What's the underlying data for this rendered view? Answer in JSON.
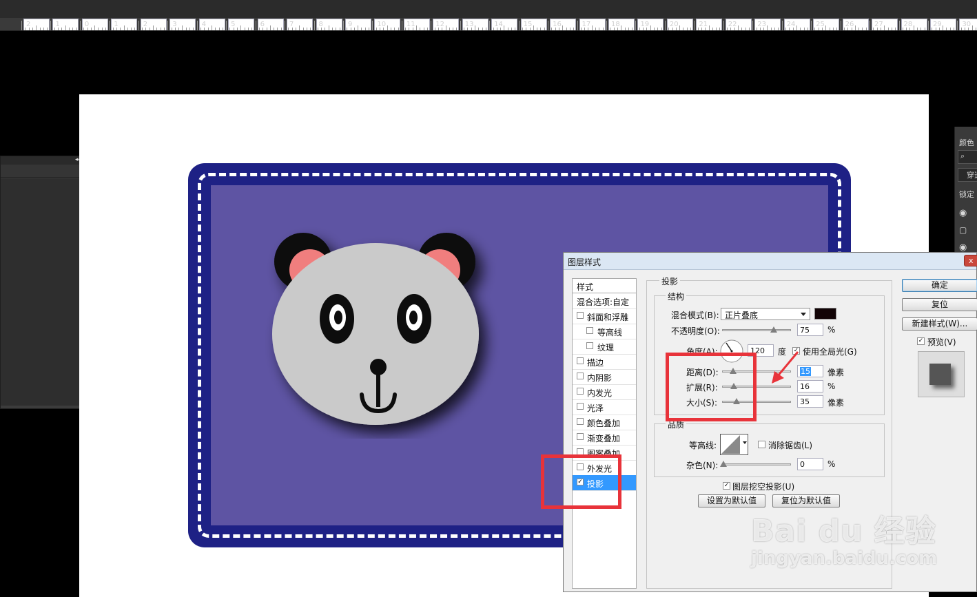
{
  "ruler": {
    "labels": [
      "2",
      "1",
      "0",
      "1",
      "2",
      "3",
      "4",
      "5",
      "6",
      "7",
      "8",
      "9",
      "10",
      "11",
      "12",
      "13",
      "14",
      "15",
      "16",
      "17",
      "18",
      "19",
      "20",
      "21",
      "22",
      "23",
      "24",
      "25",
      "26",
      "27",
      "28",
      "29",
      "30"
    ]
  },
  "colors": {
    "card_border": "#1e2185",
    "card_inner": "#5e54a3",
    "annotation_red": "#e8333a",
    "selection_blue": "#3399ff",
    "shadow_color": "#120406"
  },
  "right_panel": {
    "color_tab": "颜色",
    "blend_partial": "穿透",
    "lock_partial": "锁定"
  },
  "dialog": {
    "title": "图层样式",
    "close_label": "x",
    "styles_header": "样式",
    "blend_options": "混合选项:自定",
    "style_items": [
      {
        "label": "斜面和浮雕",
        "checked": false,
        "indent": false
      },
      {
        "label": "等高线",
        "checked": false,
        "indent": true
      },
      {
        "label": "纹理",
        "checked": false,
        "indent": true
      },
      {
        "label": "描边",
        "checked": false,
        "indent": false
      },
      {
        "label": "内阴影",
        "checked": false,
        "indent": false
      },
      {
        "label": "内发光",
        "checked": false,
        "indent": false
      },
      {
        "label": "光泽",
        "checked": false,
        "indent": false
      },
      {
        "label": "颜色叠加",
        "checked": false,
        "indent": false
      },
      {
        "label": "渐变叠加",
        "checked": false,
        "indent": false
      },
      {
        "label": "图案叠加",
        "checked": false,
        "indent": false
      },
      {
        "label": "外发光",
        "checked": false,
        "indent": false
      },
      {
        "label": "投影",
        "checked": true,
        "indent": false,
        "selected": true
      }
    ],
    "section_title": "投影",
    "structure": {
      "legend": "结构",
      "blend_mode_label": "混合模式(B):",
      "blend_mode_value": "正片叠底",
      "opacity_label": "不透明度(O):",
      "opacity_value": "75",
      "opacity_unit": "%",
      "angle_label": "角度(A):",
      "angle_value": "120",
      "angle_unit": "度",
      "global_light_label": "使用全局光(G)",
      "global_light_checked": true,
      "distance_label": "距离(D):",
      "distance_value": "15",
      "distance_unit": "像素",
      "spread_label": "扩展(R):",
      "spread_value": "16",
      "spread_unit": "%",
      "size_label": "大小(S):",
      "size_value": "35",
      "size_unit": "像素"
    },
    "quality": {
      "legend": "品质",
      "contour_label": "等高线:",
      "antialias_label": "消除锯齿(L)",
      "noise_label": "杂色(N):",
      "noise_value": "0",
      "noise_unit": "%"
    },
    "knockout_label": "图层挖空投影(U)",
    "make_default": "设置为默认值",
    "reset_default": "复位为默认值",
    "buttons": {
      "ok": "确定",
      "reset": "复位",
      "new_style": "新建样式(W)...",
      "preview_label": "预览(V)"
    }
  },
  "watermark": {
    "brand": "Bai du 经验",
    "url": "jingyan.baidu.com"
  }
}
